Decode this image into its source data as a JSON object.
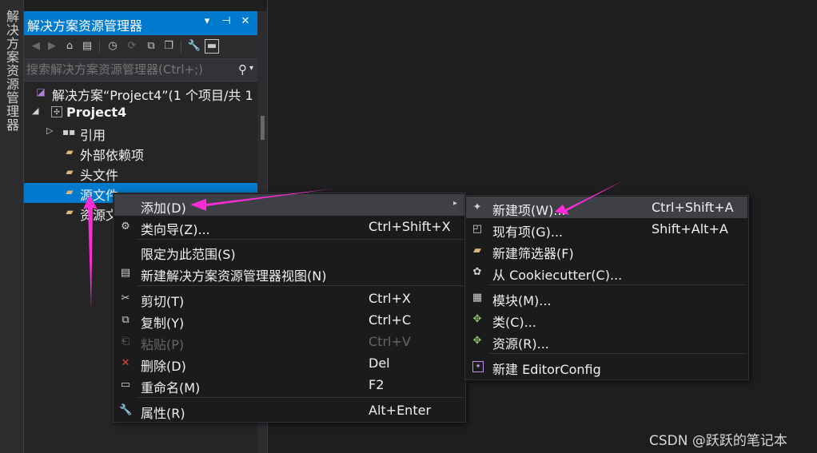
{
  "side_tab": {
    "label": "解决方案资源管理器"
  },
  "panel": {
    "title": "解决方案资源管理器",
    "search_placeholder": "搜索解决方案资源管理器(Ctrl+;)",
    "tree": [
      {
        "label": "解决方案“Project4”(1 个项目/共 1"
      },
      {
        "label": "Project4"
      },
      {
        "label": "引用"
      },
      {
        "label": "外部依赖项"
      },
      {
        "label": "头文件"
      },
      {
        "label": "源文件"
      },
      {
        "label": "资源文件"
      }
    ]
  },
  "context_menu": {
    "items": [
      {
        "label": "添加(D)",
        "shortcut": "",
        "icon": "none"
      },
      {
        "label": "类向导(Z)...",
        "shortcut": "Ctrl+Shift+X",
        "icon": "class-wizard-icon"
      },
      {
        "label": "限定为此范围(S)",
        "shortcut": "",
        "icon": "none"
      },
      {
        "label": "新建解决方案资源管理器视图(N)",
        "shortcut": "",
        "icon": "new-view-icon"
      },
      {
        "label": "剪切(T)",
        "shortcut": "Ctrl+X",
        "icon": "scissors-icon"
      },
      {
        "label": "复制(Y)",
        "shortcut": "Ctrl+C",
        "icon": "copy-icon"
      },
      {
        "label": "粘贴(P)",
        "shortcut": "Ctrl+V",
        "icon": "paste-icon"
      },
      {
        "label": "删除(D)",
        "shortcut": "Del",
        "icon": "delete-icon"
      },
      {
        "label": "重命名(M)",
        "shortcut": "F2",
        "icon": "rename-icon"
      },
      {
        "label": "属性(R)",
        "shortcut": "Alt+Enter",
        "icon": "wrench-icon"
      }
    ]
  },
  "submenu": {
    "items": [
      {
        "label": "新建项(W)...",
        "shortcut": "Ctrl+Shift+A",
        "icon": "new-item-icon"
      },
      {
        "label": "现有项(G)...",
        "shortcut": "Shift+Alt+A",
        "icon": "existing-item-icon"
      },
      {
        "label": "新建筛选器(F)",
        "shortcut": "",
        "icon": "folder-icon"
      },
      {
        "label": "从 Cookiecutter(C)...",
        "shortcut": "",
        "icon": "cookie-icon"
      },
      {
        "label": "模块(M)...",
        "shortcut": "",
        "icon": "module-icon"
      },
      {
        "label": "类(C)...",
        "shortcut": "",
        "icon": "class-icon"
      },
      {
        "label": "资源(R)...",
        "shortcut": "",
        "icon": "resource-icon"
      },
      {
        "label": "新建 EditorConfig",
        "shortcut": "",
        "icon": "editorconfig-icon"
      }
    ]
  },
  "watermark": "CSDN @跃跃的笔记本",
  "colors": {
    "accent": "#007acc",
    "annotation_arrow": "#ff2bd6"
  }
}
